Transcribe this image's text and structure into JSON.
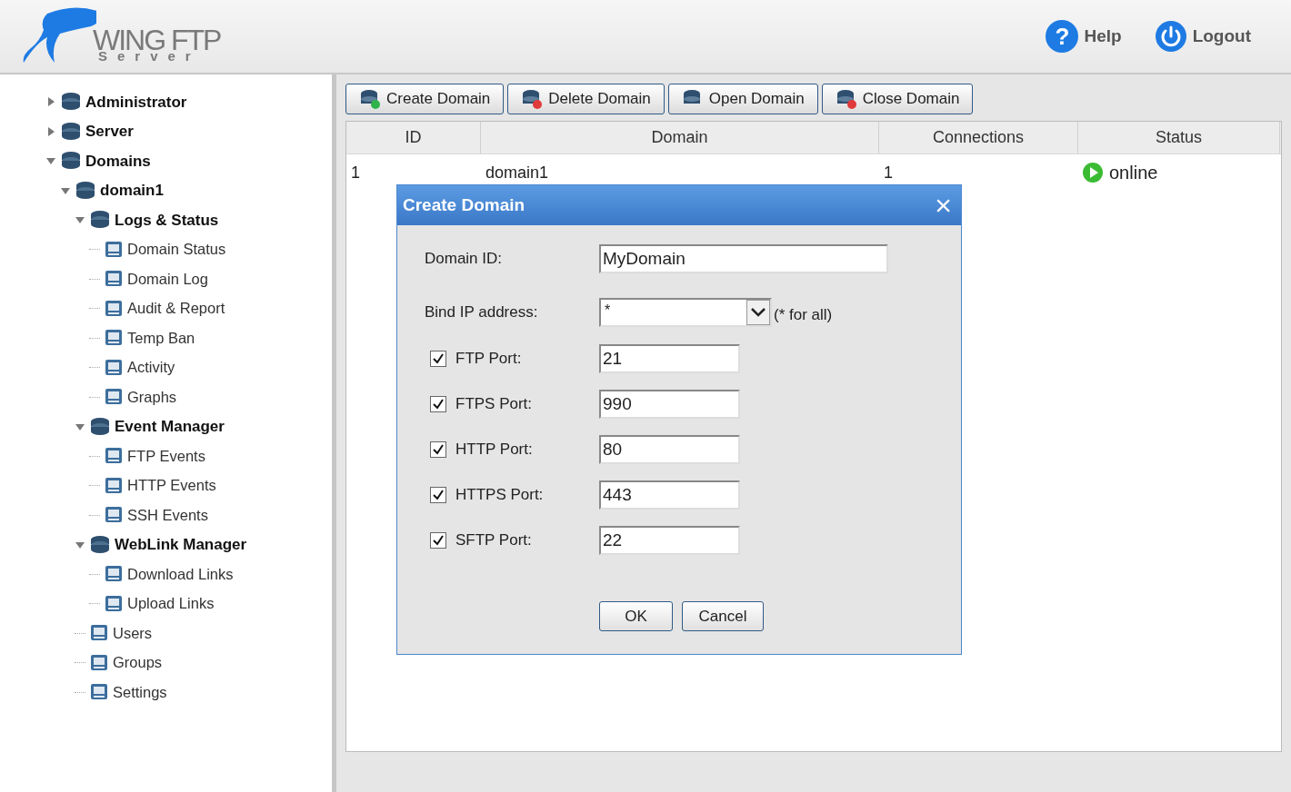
{
  "header": {
    "logo_title": "WING FTP",
    "logo_subtitle": "Server",
    "links": [
      {
        "kind": "help",
        "label": "Help",
        "glyph": "?"
      },
      {
        "kind": "logout",
        "label": "Logout"
      }
    ]
  },
  "tree": [
    {
      "label": "Administrator",
      "kind": "section",
      "expanded": false
    },
    {
      "label": "Server",
      "kind": "section",
      "expanded": false
    },
    {
      "label": "Domains",
      "kind": "section",
      "expanded": true,
      "children": [
        {
          "label": "domain1",
          "kind": "section",
          "expanded": true,
          "children": [
            {
              "label": "Logs & Status",
              "kind": "section",
              "expanded": true,
              "children": [
                {
                  "label": "Domain Status",
                  "kind": "item"
                },
                {
                  "label": "Domain Log",
                  "kind": "item"
                },
                {
                  "label": "Audit & Report",
                  "kind": "item"
                },
                {
                  "label": "Temp Ban",
                  "kind": "item"
                },
                {
                  "label": "Activity",
                  "kind": "item"
                },
                {
                  "label": "Graphs",
                  "kind": "item"
                }
              ]
            },
            {
              "label": "Event Manager",
              "kind": "section",
              "expanded": true,
              "children": [
                {
                  "label": "FTP Events",
                  "kind": "item"
                },
                {
                  "label": "HTTP Events",
                  "kind": "item"
                },
                {
                  "label": "SSH Events",
                  "kind": "item"
                }
              ]
            },
            {
              "label": "WebLink Manager",
              "kind": "section",
              "expanded": true,
              "children": [
                {
                  "label": "Download Links",
                  "kind": "item"
                },
                {
                  "label": "Upload Links",
                  "kind": "item"
                }
              ]
            },
            {
              "label": "Users",
              "kind": "item"
            },
            {
              "label": "Groups",
              "kind": "item"
            },
            {
              "label": "Settings",
              "kind": "item"
            }
          ]
        }
      ]
    }
  ],
  "toolbar": [
    {
      "label": "Create Domain",
      "kind": "create"
    },
    {
      "label": "Delete Domain",
      "kind": "delete"
    },
    {
      "label": "Open Domain",
      "kind": "open"
    },
    {
      "label": "Close Domain",
      "kind": "close"
    }
  ],
  "table": {
    "columns": [
      "ID",
      "Domain",
      "Connections",
      "Status"
    ],
    "rows": [
      {
        "id": "1",
        "domain": "domain1",
        "connections": "1",
        "status": "online",
        "online": true
      }
    ]
  },
  "dialog": {
    "title": "Create Domain",
    "close_glyph": "×",
    "domain_id": {
      "label": "Domain ID:",
      "value": "MyDomain"
    },
    "bind_ip": {
      "label": "Bind IP address:",
      "value": "*",
      "hint": "(* for all)"
    },
    "ports": [
      {
        "label": "FTP Port:",
        "value": "21",
        "checked": true
      },
      {
        "label": "FTPS Port:",
        "value": "990",
        "checked": true
      },
      {
        "label": "HTTP Port:",
        "value": "80",
        "checked": true
      },
      {
        "label": "HTTPS Port:",
        "value": "443",
        "checked": true
      },
      {
        "label": "SFTP Port:",
        "value": "22",
        "checked": true
      }
    ],
    "buttons": [
      "OK",
      "Cancel"
    ]
  }
}
